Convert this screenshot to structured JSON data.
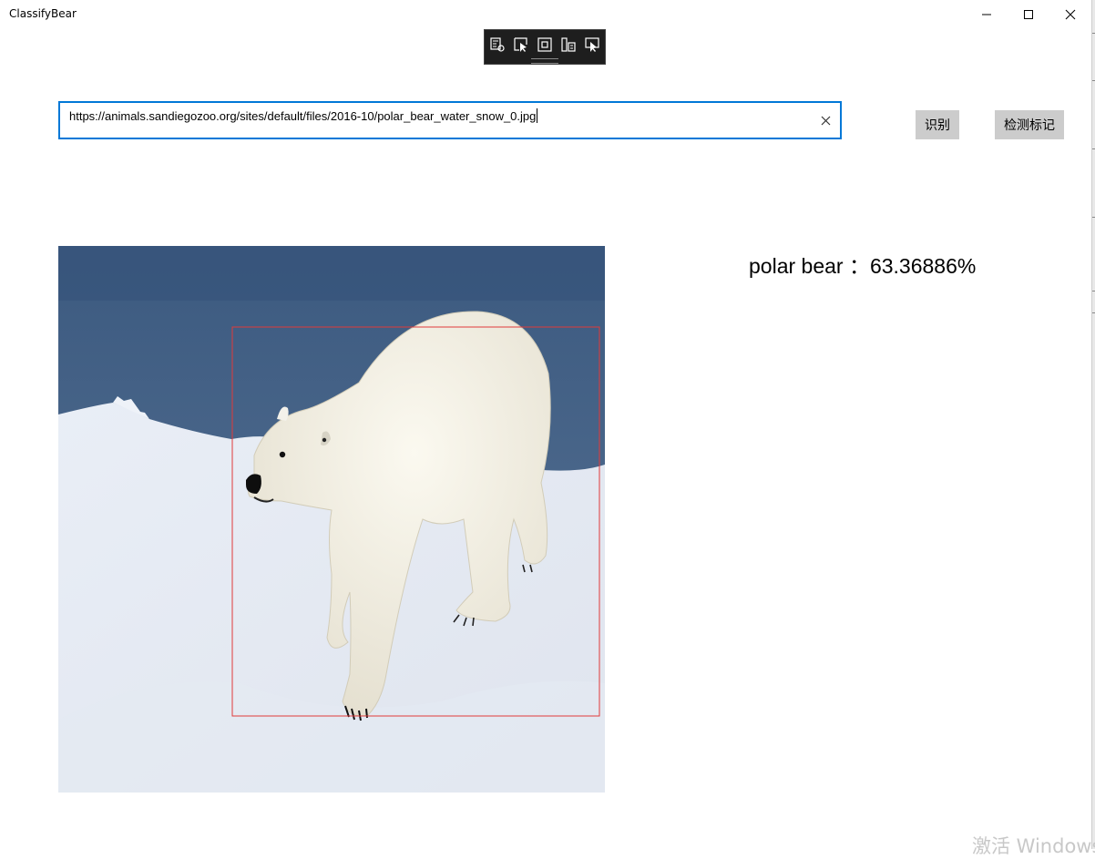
{
  "window": {
    "title": "ClassifyBear",
    "controls": {
      "minimize_icon": "minimize-icon",
      "maximize_icon": "maximize-icon",
      "close_icon": "close-icon"
    }
  },
  "debug_toolbar": {
    "icons": [
      "live-visual-tree-icon",
      "select-element-icon",
      "display-layout-adorners-icon",
      "track-focus-icon",
      "accessibility-preview-icon"
    ],
    "background": "#1e1e1e"
  },
  "url_input": {
    "value": "https://animals.sandiegozoo.org/sites/default/files/2016-10/polar_bear_water_snow_0.jpg",
    "clear_icon": "clear-icon",
    "border_color": "#0078d7"
  },
  "buttons": {
    "identify_label": "识别",
    "detect_label": "检测标记",
    "background": "#cccccc"
  },
  "result": {
    "text": "polar bear ：63.36886%"
  },
  "image": {
    "subject": "polar-bear-photo",
    "detection_box_color": "#e03a3a"
  },
  "watermark": {
    "text": "激活 Windows"
  }
}
